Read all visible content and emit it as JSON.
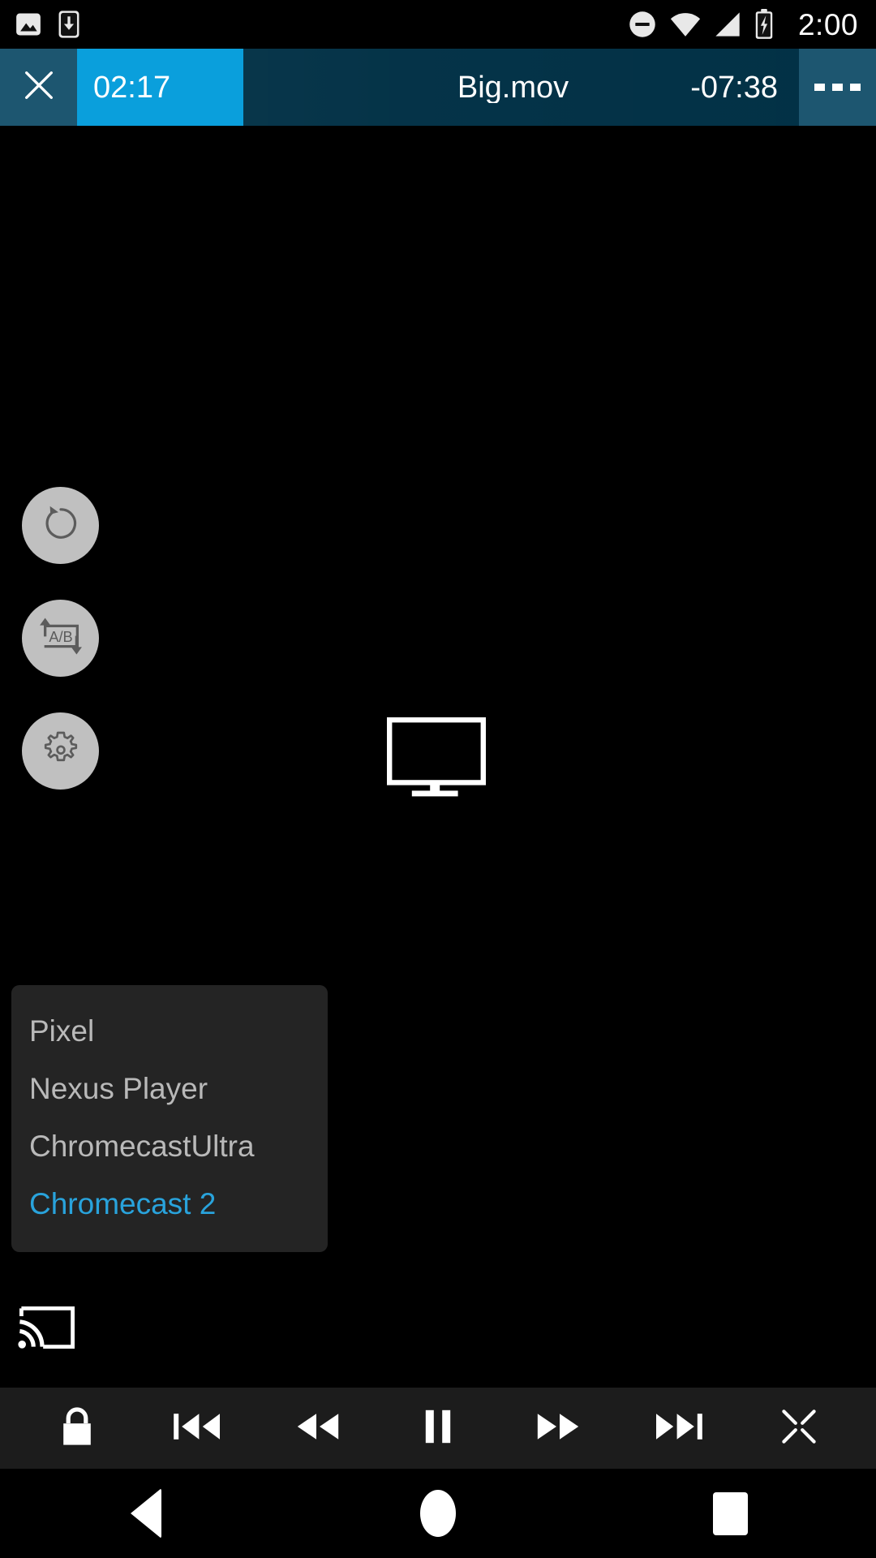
{
  "status_bar": {
    "time": "2:00",
    "left_icons": [
      {
        "name": "screenshot-image-icon"
      },
      {
        "name": "download-icon"
      }
    ],
    "right_icons": [
      {
        "name": "do-not-disturb-icon"
      },
      {
        "name": "wifi-icon"
      },
      {
        "name": "cellular-signal-icon"
      },
      {
        "name": "battery-charging-icon"
      }
    ]
  },
  "player_bar": {
    "close_label": "close-icon",
    "elapsed_time": "02:17",
    "title": "Big.mov",
    "remaining_time": "-07:38",
    "overflow_label": "overflow-menu-icon",
    "progress_percent": 23,
    "accent_color": "#0a9fdc",
    "bar_bg_color": "#023146",
    "edge_color": "#1d5670"
  },
  "side_buttons": [
    {
      "name": "rotate-screen-button",
      "icon": "rotate-loop-icon"
    },
    {
      "name": "ab-repeat-button",
      "icon": "ab-repeat-icon",
      "label": "A/B"
    },
    {
      "name": "settings-button",
      "icon": "gear-icon"
    }
  ],
  "cast_stage": {
    "target_icon": "monitor-icon",
    "cast_icon": "cast-icon"
  },
  "device_list": {
    "selected": "Chromecast 2",
    "selected_color": "#29a3dc",
    "items": [
      {
        "label": "Pixel",
        "selected": false
      },
      {
        "label": "Nexus Player",
        "selected": false
      },
      {
        "label": "ChromecastUltra",
        "selected": false
      },
      {
        "label": "Chromecast 2",
        "selected": true
      }
    ]
  },
  "controls": [
    {
      "name": "lock-button",
      "icon": "lock-icon"
    },
    {
      "name": "previous-button",
      "icon": "skip-previous-icon"
    },
    {
      "name": "rewind-button",
      "icon": "rewind-icon"
    },
    {
      "name": "pause-button",
      "icon": "pause-icon"
    },
    {
      "name": "fast-forward-button",
      "icon": "fast-forward-icon"
    },
    {
      "name": "next-button",
      "icon": "skip-next-icon"
    },
    {
      "name": "fullscreen-button",
      "icon": "fullscreen-expand-icon"
    }
  ],
  "nav_bar": [
    {
      "name": "nav-back-button",
      "icon": "back-triangle-icon"
    },
    {
      "name": "nav-home-button",
      "icon": "home-circle-icon"
    },
    {
      "name": "nav-recents-button",
      "icon": "recents-square-icon"
    }
  ]
}
